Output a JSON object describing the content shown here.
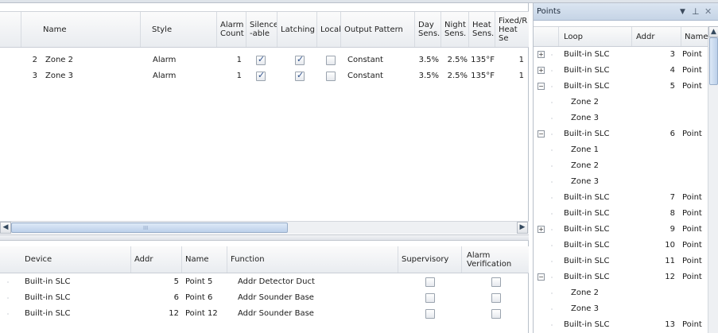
{
  "zones_grid": {
    "headers": {
      "name": "Name",
      "style": "Style",
      "alarm_count": "Alarm Count",
      "silenceable": "Silence -able",
      "latching": "Latching",
      "local": "Local",
      "output_pattern": "Output Pattern",
      "day_sens": "Day Sens.",
      "night_sens": "Night Sens.",
      "heat_sens": "Heat Sens.",
      "fixed_heat": "Fixed/R Heat Se"
    },
    "rows": [
      {
        "num": "2",
        "name": "Zone 2",
        "style": "Alarm",
        "alarm_count": "1",
        "silenceable": true,
        "latching": true,
        "local": false,
        "output_pattern": "Constant",
        "day_sens": "3.5%",
        "night_sens": "2.5%",
        "heat_sens": "135°F",
        "fixed_heat": "1"
      },
      {
        "num": "3",
        "name": "Zone 3",
        "style": "Alarm",
        "alarm_count": "1",
        "silenceable": true,
        "latching": true,
        "local": false,
        "output_pattern": "Constant",
        "day_sens": "3.5%",
        "night_sens": "2.5%",
        "heat_sens": "135°F",
        "fixed_heat": "1"
      }
    ],
    "scroll_thumb_label": "III"
  },
  "devices_grid": {
    "headers": {
      "device": "Device",
      "addr": "Addr",
      "name": "Name",
      "function": "Function",
      "supervisory": "Supervisory",
      "alarm_verification": "Alarm Verification"
    },
    "rows": [
      {
        "device": "Built-in SLC",
        "addr": "5",
        "name": "Point 5",
        "function": "Addr Detector Duct",
        "supervisory": false,
        "alarm_verification": false
      },
      {
        "device": "Built-in SLC",
        "addr": "6",
        "name": "Point 6",
        "function": "Addr Sounder Base",
        "supervisory": false,
        "alarm_verification": false
      },
      {
        "device": "Built-in SLC",
        "addr": "12",
        "name": "Point 12",
        "function": "Addr Sounder Base",
        "supervisory": false,
        "alarm_verification": false
      }
    ]
  },
  "points_panel": {
    "title": "Points",
    "headers": {
      "loop": "Loop",
      "addr": "Addr",
      "name": "Name"
    },
    "rows": [
      {
        "expander": "+",
        "loop": "Built-in SLC",
        "addr": "3",
        "name": "Point",
        "child": false
      },
      {
        "expander": "+",
        "loop": "Built-in SLC",
        "addr": "4",
        "name": "Point",
        "child": false
      },
      {
        "expander": "-",
        "loop": "Built-in SLC",
        "addr": "5",
        "name": "Point",
        "child": false
      },
      {
        "expander": "",
        "loop": "Zone 2",
        "addr": "",
        "name": "",
        "child": true
      },
      {
        "expander": "",
        "loop": "Zone 3",
        "addr": "",
        "name": "",
        "child": true
      },
      {
        "expander": "-",
        "loop": "Built-in SLC",
        "addr": "6",
        "name": "Point",
        "child": false
      },
      {
        "expander": "",
        "loop": "Zone 1",
        "addr": "",
        "name": "",
        "child": true
      },
      {
        "expander": "",
        "loop": "Zone 2",
        "addr": "",
        "name": "",
        "child": true
      },
      {
        "expander": "",
        "loop": "Zone 3",
        "addr": "",
        "name": "",
        "child": true
      },
      {
        "expander": "",
        "loop": "Built-in SLC",
        "addr": "7",
        "name": "Point",
        "child": false
      },
      {
        "expander": "",
        "loop": "Built-in SLC",
        "addr": "8",
        "name": "Point",
        "child": false
      },
      {
        "expander": "+",
        "loop": "Built-in SLC",
        "addr": "9",
        "name": "Point",
        "child": false
      },
      {
        "expander": "",
        "loop": "Built-in SLC",
        "addr": "10",
        "name": "Point",
        "child": false
      },
      {
        "expander": "",
        "loop": "Built-in SLC",
        "addr": "11",
        "name": "Point",
        "child": false
      },
      {
        "expander": "-",
        "loop": "Built-in SLC",
        "addr": "12",
        "name": "Point",
        "child": false
      },
      {
        "expander": "",
        "loop": "Zone 2",
        "addr": "",
        "name": "",
        "child": true
      },
      {
        "expander": "",
        "loop": "Zone 3",
        "addr": "",
        "name": "",
        "child": true
      },
      {
        "expander": "",
        "loop": "Built-in SLC",
        "addr": "13",
        "name": "Point",
        "child": false
      }
    ]
  }
}
